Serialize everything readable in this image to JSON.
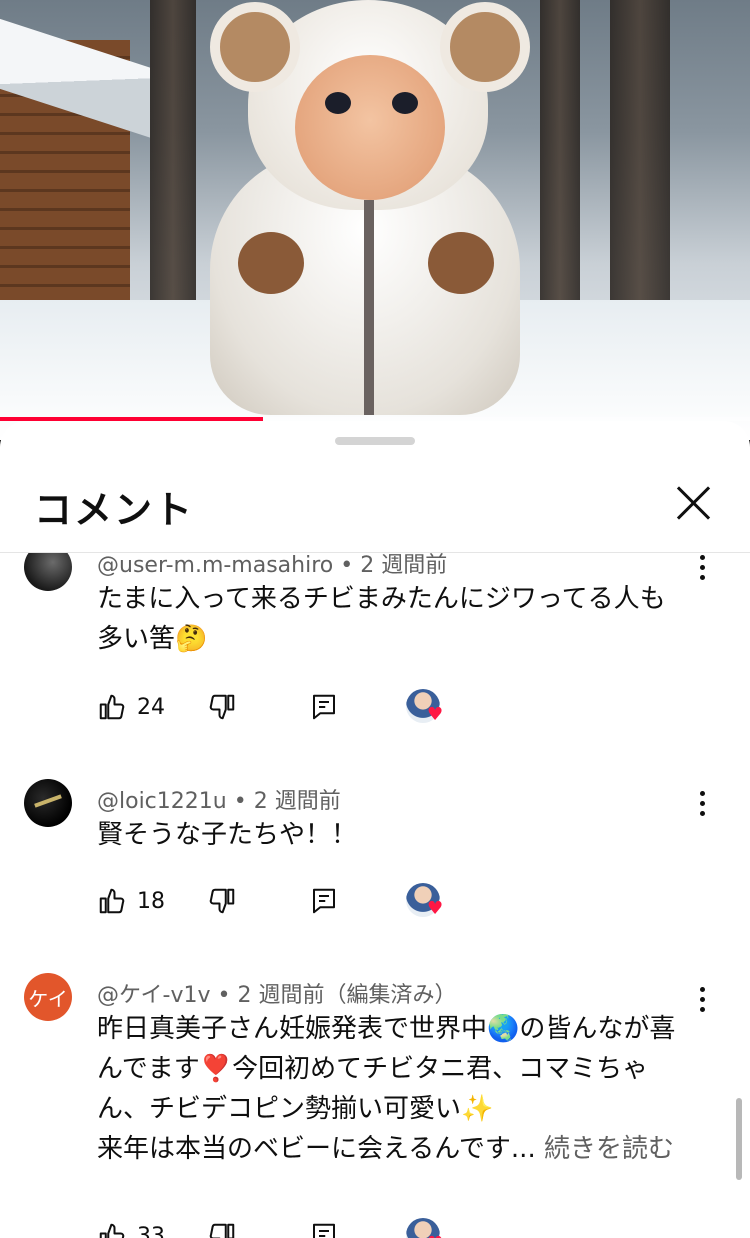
{
  "video": {
    "progress_fraction": 0.35
  },
  "sheet": {
    "title": "コメント"
  },
  "comments": [
    {
      "author": "@user-m.m-masahiro",
      "time": "2 週間前",
      "edited": "",
      "lines": [
        "たまに入って来るチビまみたんにジワってる人も",
        "多い筈🤔"
      ],
      "more_label": "",
      "likes": "24"
    },
    {
      "author": "@loic1221u",
      "time": "2 週間前",
      "edited": "",
      "lines": [
        "賢そうな子たちや！！"
      ],
      "more_label": "",
      "likes": "18"
    },
    {
      "author": "@ケイ-v1v",
      "avatar_text": "ケイ",
      "time": "2 週間前",
      "edited": "（編集済み）",
      "lines": [
        "昨日真美子さん妊娠発表で世界中🌏の皆んなが喜",
        "んでます❣️今回初めてチビタニ君、コマミちゃ",
        "ん、チビデコピン勢揃い可愛い✨",
        "来年は本当のベビーに会えるんです..."
      ],
      "more_label": "続きを読む",
      "likes": "33"
    }
  ],
  "colors": {
    "accent": "#ff0033",
    "heart": "#ff1744",
    "avatar_orange": "#e2562b"
  },
  "icons": [
    "like-icon",
    "dislike-icon",
    "reply-icon",
    "close-icon",
    "more-vert-icon",
    "heart-icon"
  ]
}
